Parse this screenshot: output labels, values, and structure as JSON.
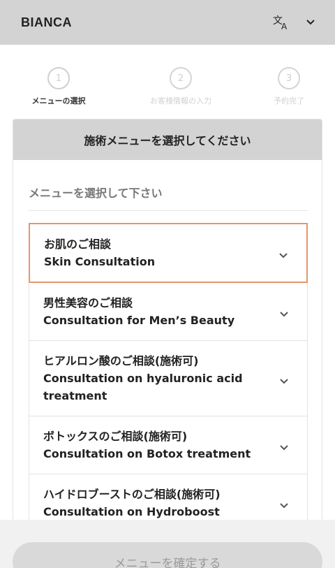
{
  "header": {
    "brand": "BIANCA",
    "language_icon": "translate-icon",
    "dropdown_icon": "chevron-down-icon"
  },
  "steps": [
    {
      "number": "1",
      "label": "メニューの選択",
      "active": true
    },
    {
      "number": "2",
      "label": "お客様情報の入力",
      "active": false
    },
    {
      "number": "3",
      "label": "予約完了",
      "active": false
    }
  ],
  "panel": {
    "title": "施術メニューを選択してください",
    "subtitle": "メニューを選択して下さい"
  },
  "menu_items": [
    {
      "jp": "お肌のご相談",
      "en": "Skin Consultation"
    },
    {
      "jp": "男性美容のご相談",
      "en": "Consultation for Men’s Beauty"
    },
    {
      "jp": "ヒアルロン酸のご相談(施術可)",
      "en": "Consultation on hyaluronic acid treatment"
    },
    {
      "jp": "ボトックスのご相談(施術可)",
      "en": "Consultation on Botox treatment"
    },
    {
      "jp": "ハイドロブーストのご相談(施術可)",
      "en": "Consultation on Hydroboost"
    }
  ],
  "footer": {
    "confirm_label": "メニューを確定する"
  },
  "colors": {
    "header_bg": "#d3d3d3",
    "selected_border": "#e8956a",
    "button_bg": "#d9d9d9"
  }
}
